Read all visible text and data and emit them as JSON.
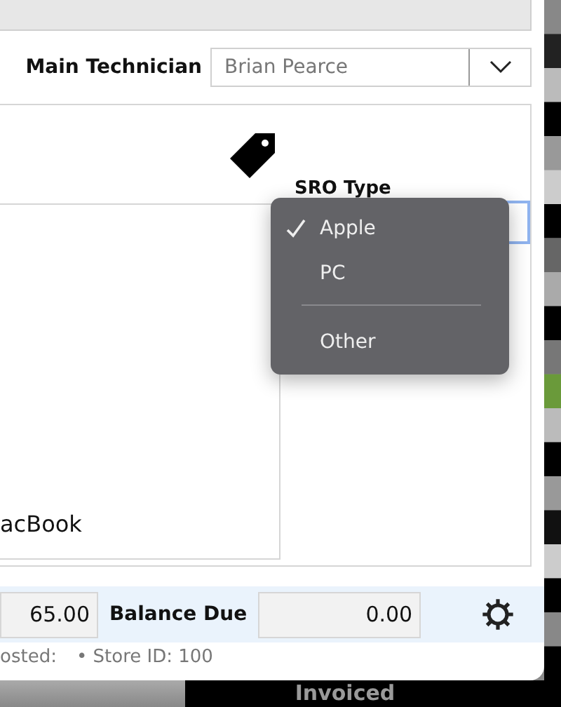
{
  "technician": {
    "label": "Main Technician",
    "value": "Brian Pearce"
  },
  "sro_type": {
    "label": "SRO Type",
    "focused": true
  },
  "menu": [
    {
      "kind": "item",
      "label": "Apple",
      "selected": true
    },
    {
      "kind": "item",
      "label": "PC",
      "selected": false
    },
    {
      "kind": "divider"
    },
    {
      "kind": "item",
      "label": "Other",
      "selected": false
    }
  ],
  "device_text": "acBook",
  "totals": {
    "amount": "65.00",
    "balance_label": "Balance Due",
    "balance": "0.00"
  },
  "status_bar": [
    "osted:",
    "• Store ID: 100"
  ],
  "background_label": "Invoiced"
}
